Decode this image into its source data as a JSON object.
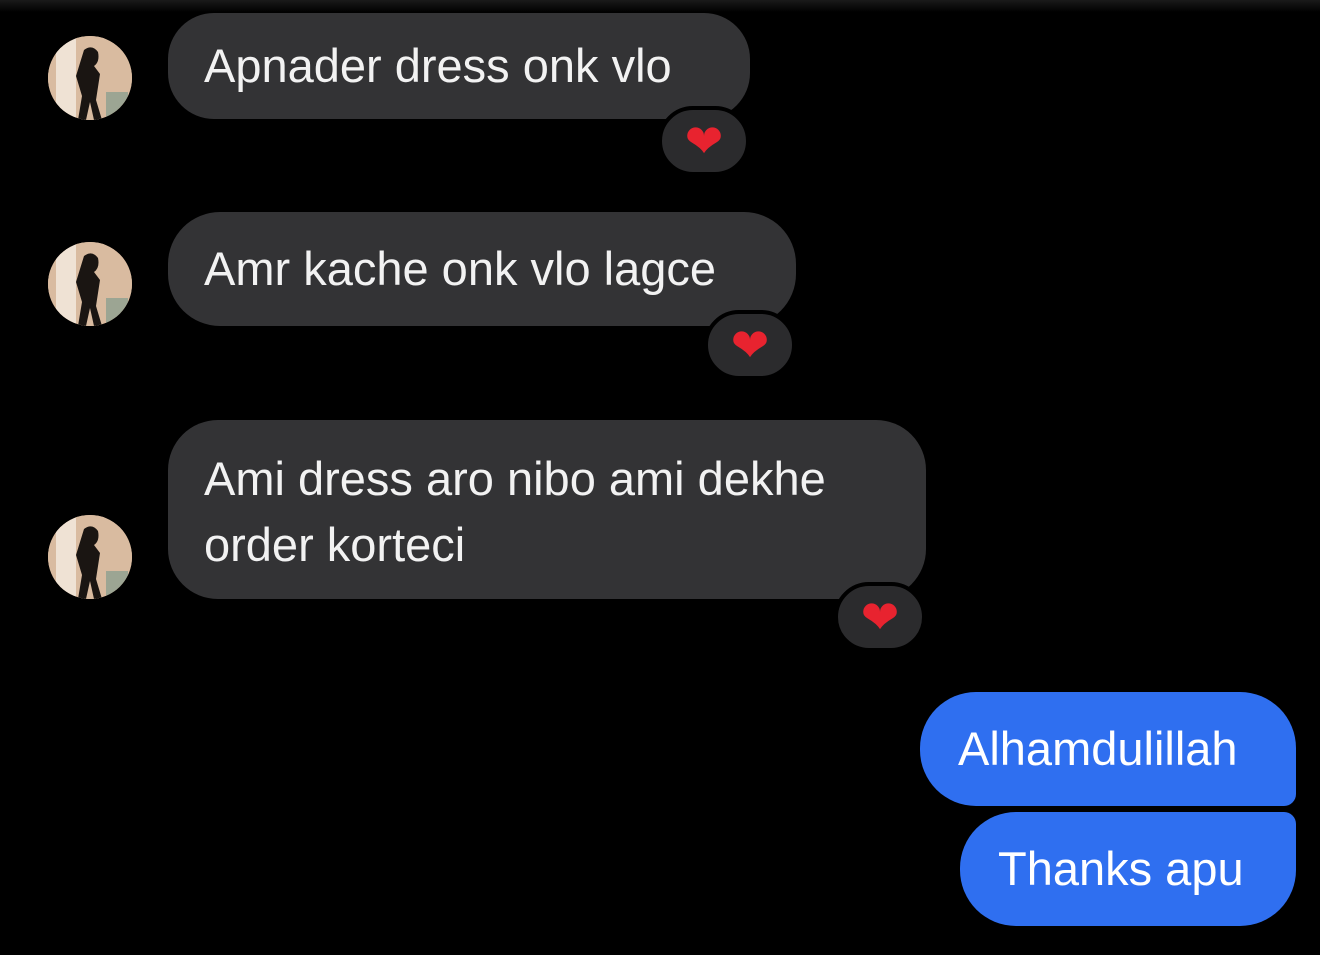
{
  "messages": [
    {
      "sender": "contact",
      "text": "Apnader dress onk vlo",
      "reaction": "❤"
    },
    {
      "sender": "contact",
      "text": "Amr kache onk vlo lagce",
      "reaction": "❤"
    },
    {
      "sender": "contact",
      "text": "Ami dress aro nibo ami dekhe order korteci",
      "reaction": "❤"
    },
    {
      "sender": "me",
      "text": "Alhamdulillah"
    },
    {
      "sender": "me",
      "text": "Thanks apu"
    }
  ],
  "colors": {
    "background": "#000000",
    "incoming_bubble": "#333335",
    "outgoing_bubble": "#2f6ff0",
    "reaction_heart": "#e8232f"
  },
  "icons": {
    "reaction": "heart-icon",
    "avatar": "contact-avatar"
  }
}
